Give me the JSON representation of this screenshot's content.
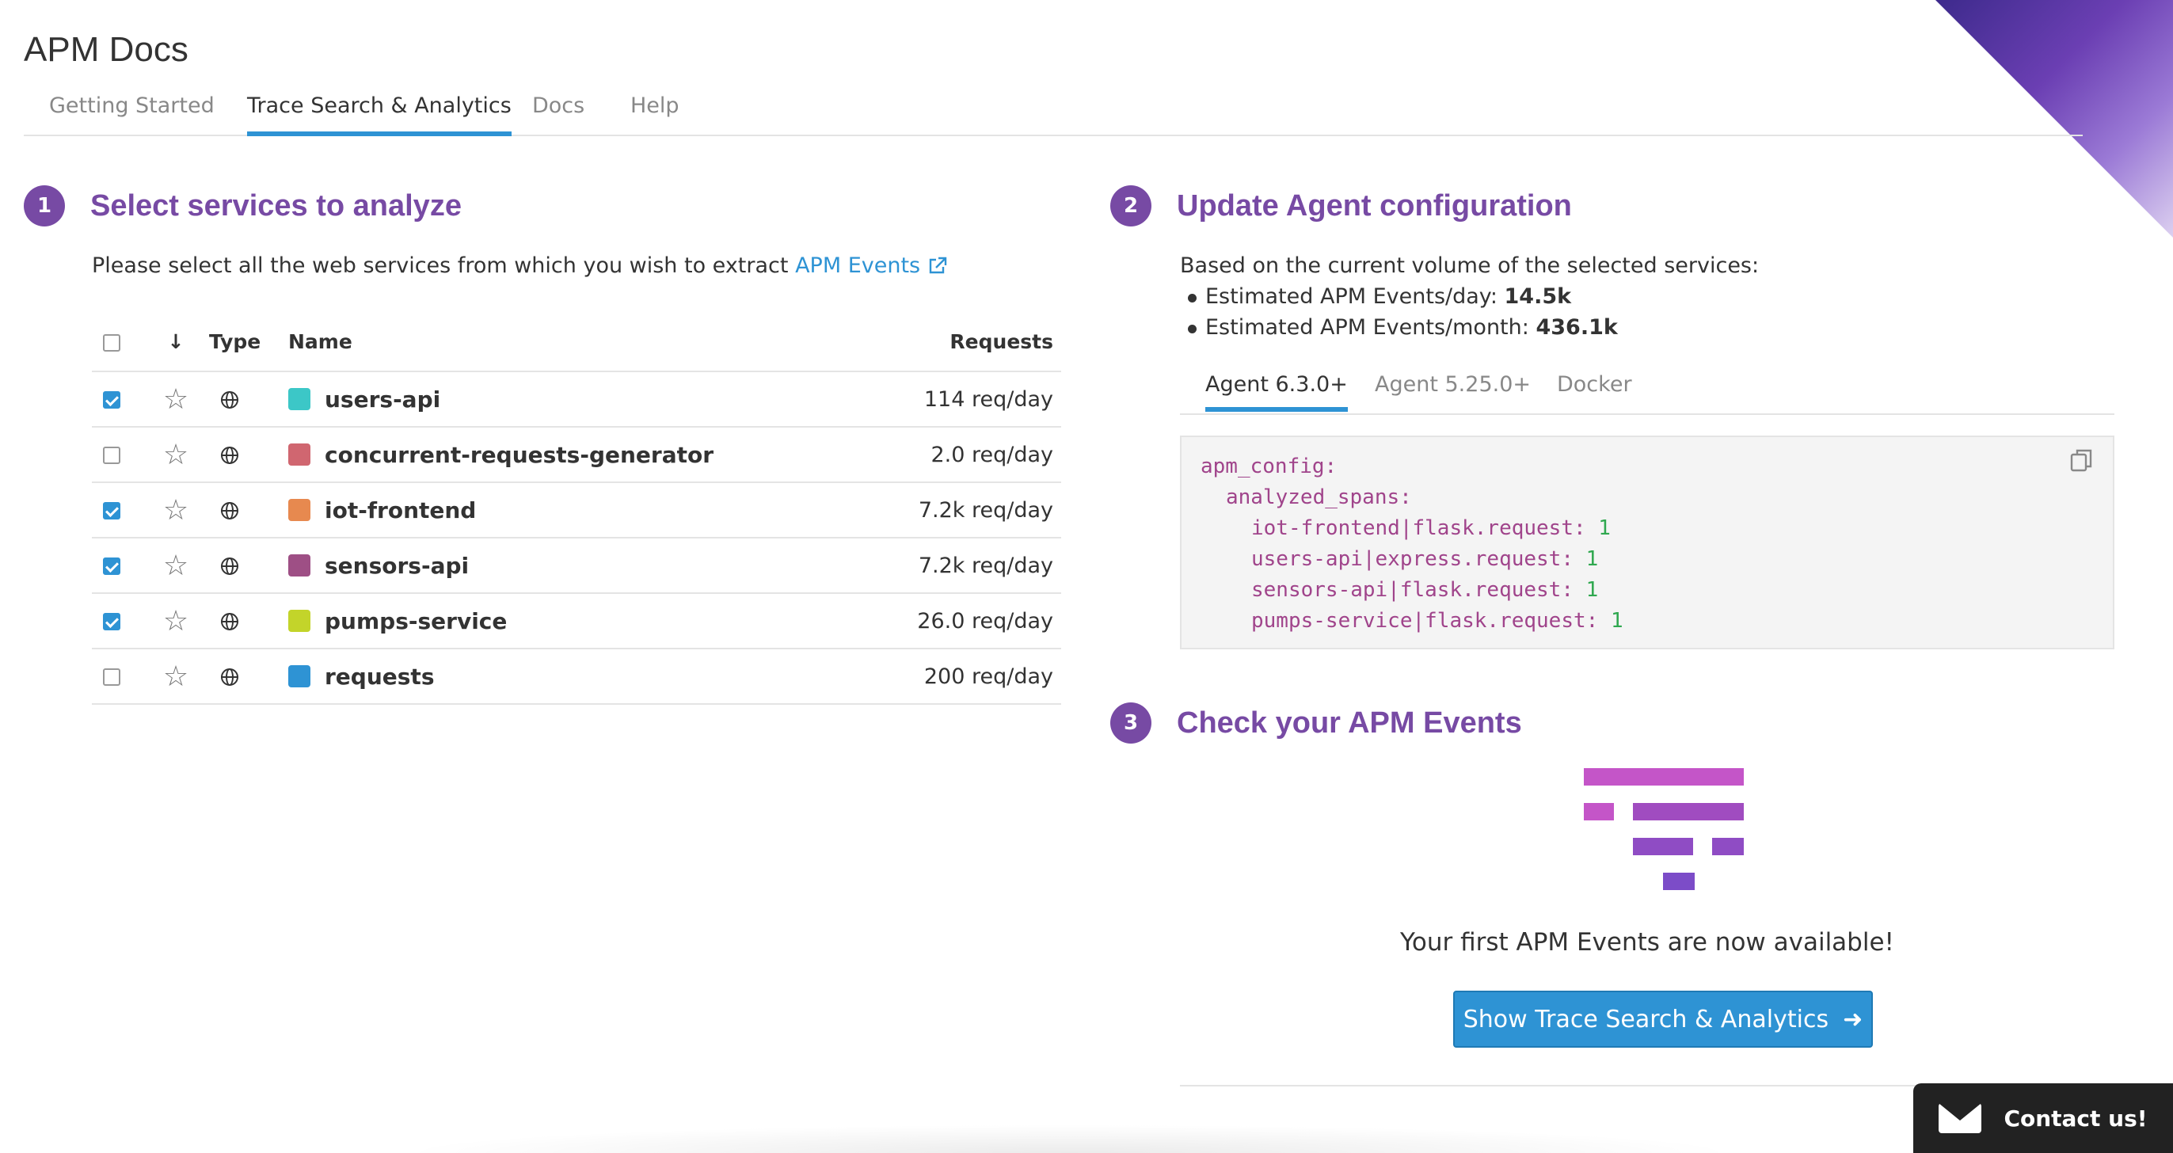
{
  "app": {
    "title": "APM Docs"
  },
  "tabs": [
    {
      "label": "Getting Started"
    },
    {
      "label": "Trace Search & Analytics",
      "active": true
    },
    {
      "label": "Docs"
    },
    {
      "label": "Help"
    }
  ],
  "step1": {
    "number": "1",
    "title": "Select services to analyze",
    "intro": "Please select all the web services from which you wish to extract",
    "link": "APM Events",
    "columns": {
      "sort_arrow": "↓",
      "type": "Type",
      "name": "Name",
      "requests": "Requests"
    },
    "services": [
      {
        "name": "users-api",
        "requests": "114 req/day",
        "checked": true,
        "color": "#3cc7c7"
      },
      {
        "name": "concurrent-requests-generator",
        "requests": "2.0 req/day",
        "checked": false,
        "color": "#d06670"
      },
      {
        "name": "iot-frontend",
        "requests": "7.2k req/day",
        "checked": true,
        "color": "#e7894f"
      },
      {
        "name": "sensors-api",
        "requests": "7.2k req/day",
        "checked": true,
        "color": "#9e4f85"
      },
      {
        "name": "pumps-service",
        "requests": "26.0 req/day",
        "checked": true,
        "color": "#c3d42a"
      },
      {
        "name": "requests",
        "requests": "200 req/day",
        "checked": false,
        "color": "#2e93d4"
      }
    ]
  },
  "step2": {
    "number": "2",
    "title": "Update Agent configuration",
    "intro": "Based on the current volume of the selected services:",
    "bullets": [
      {
        "label": "Estimated APM Events/day:",
        "value": "14.5k"
      },
      {
        "label": "Estimated APM Events/month:",
        "value": "436.1k"
      }
    ],
    "agent_tabs": [
      {
        "label": "Agent 6.3.0+",
        "active": true
      },
      {
        "label": "Agent 5.25.0+"
      },
      {
        "label": "Docker"
      }
    ],
    "code": {
      "line1_key": "apm_config:",
      "line2_key": "analyzed_spans:",
      "entries": [
        {
          "key": "iot-frontend|flask.request:",
          "value": "1"
        },
        {
          "key": "users-api|express.request:",
          "value": "1"
        },
        {
          "key": "sensors-api|flask.request:",
          "value": "1"
        },
        {
          "key": "pumps-service|flask.request:",
          "value": "1"
        }
      ]
    }
  },
  "step3": {
    "number": "3",
    "title": "Check your APM Events",
    "message": "Your first APM Events are now available!",
    "button": "Show Trace Search & Analytics",
    "button_arrow": "➜"
  },
  "contact": {
    "label": "Contact us!"
  },
  "colors": {
    "accent_purple": "#774aa4",
    "accent_blue": "#2e93d4",
    "code_key": "#a0448b",
    "code_value": "#2fa84f"
  }
}
